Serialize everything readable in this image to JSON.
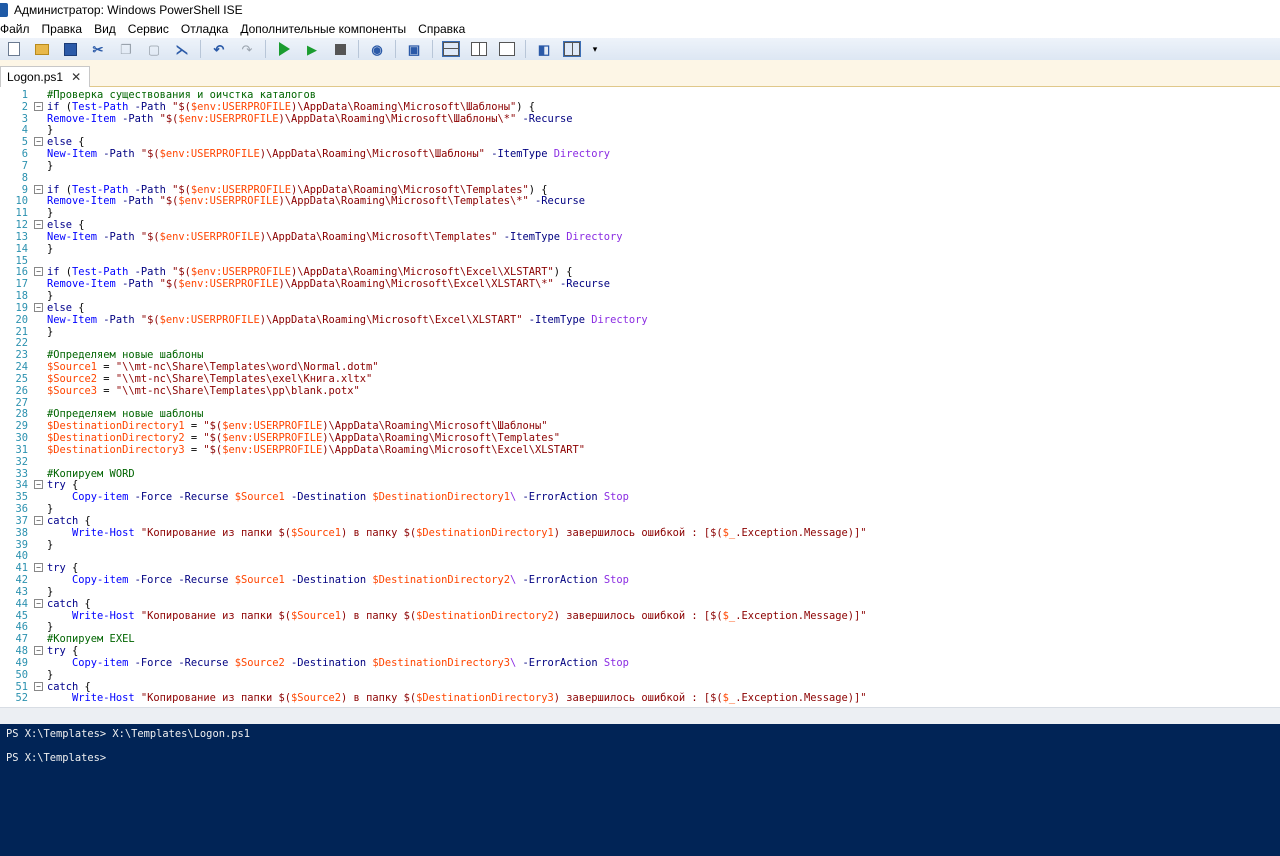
{
  "window": {
    "title": "Администратор: Windows PowerShell ISE"
  },
  "menu": [
    "Файл",
    "Правка",
    "Вид",
    "Сервис",
    "Отладка",
    "Дополнительные компоненты",
    "Справка"
  ],
  "toolbar": {
    "buttons": [
      "new-file-icon",
      "open-file-icon",
      "save-icon",
      "cut-icon",
      "copy-icon",
      "paste-icon",
      "clear-console-icon",
      "undo-icon",
      "redo-icon",
      "run-script-icon",
      "run-selection-icon",
      "stop-icon",
      "new-remote-tab-icon",
      "start-powershell-icon",
      "script-pane-top-icon",
      "script-pane-right-icon",
      "script-pane-maximized-icon",
      "show-commands-icon",
      "show-addon-icon",
      "overflow-icon"
    ]
  },
  "tabs": [
    {
      "label": "Logon.ps1",
      "close": "✕"
    }
  ],
  "editor": {
    "lines": [
      [
        {
          "t": "#Проверка существования и оичстка каталогов",
          "c": "comment"
        }
      ],
      [
        {
          "t": "if",
          "c": "kw"
        },
        {
          "t": " (",
          "c": ""
        },
        {
          "t": "Test-Path",
          "c": "cmd"
        },
        {
          "t": " -Path ",
          "c": "param"
        },
        {
          "t": "\"$(",
          "c": "str"
        },
        {
          "t": "$env:USERPROFILE",
          "c": "var"
        },
        {
          "t": ")\\AppData\\Roaming\\Microsoft\\Шаблоны\"",
          "c": "str"
        },
        {
          "t": ") {",
          "c": ""
        }
      ],
      [
        {
          "t": "Remove-Item",
          "c": "cmd"
        },
        {
          "t": " -Path ",
          "c": "param"
        },
        {
          "t": "\"$(",
          "c": "str"
        },
        {
          "t": "$env:USERPROFILE",
          "c": "var"
        },
        {
          "t": ")\\AppData\\Roaming\\Microsoft\\Шаблоны\\*\"",
          "c": "str"
        },
        {
          "t": " -Recurse",
          "c": "param"
        }
      ],
      [
        {
          "t": "}",
          "c": ""
        }
      ],
      [
        {
          "t": "else",
          "c": "kw"
        },
        {
          "t": " {",
          "c": ""
        }
      ],
      [
        {
          "t": "New-Item",
          "c": "cmd"
        },
        {
          "t": " -Path ",
          "c": "param"
        },
        {
          "t": "\"$(",
          "c": "str"
        },
        {
          "t": "$env:USERPROFILE",
          "c": "var"
        },
        {
          "t": ")\\AppData\\Roaming\\Microsoft\\Шаблоны\"",
          "c": "str"
        },
        {
          "t": " -ItemType ",
          "c": "param"
        },
        {
          "t": "Directory",
          "c": "arg"
        }
      ],
      [
        {
          "t": "}",
          "c": ""
        }
      ],
      [],
      [
        {
          "t": "if",
          "c": "kw"
        },
        {
          "t": " (",
          "c": ""
        },
        {
          "t": "Test-Path",
          "c": "cmd"
        },
        {
          "t": " -Path ",
          "c": "param"
        },
        {
          "t": "\"$(",
          "c": "str"
        },
        {
          "t": "$env:USERPROFILE",
          "c": "var"
        },
        {
          "t": ")\\AppData\\Roaming\\Microsoft\\Templates\"",
          "c": "str"
        },
        {
          "t": ") {",
          "c": ""
        }
      ],
      [
        {
          "t": "Remove-Item",
          "c": "cmd"
        },
        {
          "t": " -Path ",
          "c": "param"
        },
        {
          "t": "\"$(",
          "c": "str"
        },
        {
          "t": "$env:USERPROFILE",
          "c": "var"
        },
        {
          "t": ")\\AppData\\Roaming\\Microsoft\\Templates\\*\"",
          "c": "str"
        },
        {
          "t": " -Recurse",
          "c": "param"
        }
      ],
      [
        {
          "t": "}",
          "c": ""
        }
      ],
      [
        {
          "t": "else",
          "c": "kw"
        },
        {
          "t": " {",
          "c": ""
        }
      ],
      [
        {
          "t": "New-Item",
          "c": "cmd"
        },
        {
          "t": " -Path ",
          "c": "param"
        },
        {
          "t": "\"$(",
          "c": "str"
        },
        {
          "t": "$env:USERPROFILE",
          "c": "var"
        },
        {
          "t": ")\\AppData\\Roaming\\Microsoft\\Templates\"",
          "c": "str"
        },
        {
          "t": " -ItemType ",
          "c": "param"
        },
        {
          "t": "Directory",
          "c": "arg"
        }
      ],
      [
        {
          "t": "}",
          "c": ""
        }
      ],
      [],
      [
        {
          "t": "if",
          "c": "kw"
        },
        {
          "t": " (",
          "c": ""
        },
        {
          "t": "Test-Path",
          "c": "cmd"
        },
        {
          "t": " -Path ",
          "c": "param"
        },
        {
          "t": "\"$(",
          "c": "str"
        },
        {
          "t": "$env:USERPROFILE",
          "c": "var"
        },
        {
          "t": ")\\AppData\\Roaming\\Microsoft\\Excel\\XLSTART\"",
          "c": "str"
        },
        {
          "t": ") {",
          "c": ""
        }
      ],
      [
        {
          "t": "Remove-Item",
          "c": "cmd"
        },
        {
          "t": " -Path ",
          "c": "param"
        },
        {
          "t": "\"$(",
          "c": "str"
        },
        {
          "t": "$env:USERPROFILE",
          "c": "var"
        },
        {
          "t": ")\\AppData\\Roaming\\Microsoft\\Excel\\XLSTART\\*\"",
          "c": "str"
        },
        {
          "t": " -Recurse",
          "c": "param"
        }
      ],
      [
        {
          "t": "}",
          "c": ""
        }
      ],
      [
        {
          "t": "else",
          "c": "kw"
        },
        {
          "t": " {",
          "c": ""
        }
      ],
      [
        {
          "t": "New-Item",
          "c": "cmd"
        },
        {
          "t": " -Path ",
          "c": "param"
        },
        {
          "t": "\"$(",
          "c": "str"
        },
        {
          "t": "$env:USERPROFILE",
          "c": "var"
        },
        {
          "t": ")\\AppData\\Roaming\\Microsoft\\Excel\\XLSTART\"",
          "c": "str"
        },
        {
          "t": " -ItemType ",
          "c": "param"
        },
        {
          "t": "Directory",
          "c": "arg"
        }
      ],
      [
        {
          "t": "}",
          "c": ""
        }
      ],
      [],
      [
        {
          "t": "#Определяем новые шаблоны",
          "c": "comment"
        }
      ],
      [
        {
          "t": "$Source1",
          "c": "var"
        },
        {
          "t": " = ",
          "c": ""
        },
        {
          "t": "\"\\\\mt-nc\\Share\\Templates\\word\\Normal.dotm\"",
          "c": "str"
        }
      ],
      [
        {
          "t": "$Source2",
          "c": "var"
        },
        {
          "t": " = ",
          "c": ""
        },
        {
          "t": "\"\\\\mt-nc\\Share\\Templates\\exel\\Книга.xltx\"",
          "c": "str"
        }
      ],
      [
        {
          "t": "$Source3",
          "c": "var"
        },
        {
          "t": " = ",
          "c": ""
        },
        {
          "t": "\"\\\\mt-nc\\Share\\Templates\\pp\\blank.potx\"",
          "c": "str"
        }
      ],
      [],
      [
        {
          "t": "#Определяем новые шаблоны",
          "c": "comment"
        }
      ],
      [
        {
          "t": "$DestinationDirectory1",
          "c": "var"
        },
        {
          "t": " = ",
          "c": ""
        },
        {
          "t": "\"$(",
          "c": "str"
        },
        {
          "t": "$env:USERPROFILE",
          "c": "var"
        },
        {
          "t": ")\\AppData\\Roaming\\Microsoft\\Шаблоны\"",
          "c": "str"
        }
      ],
      [
        {
          "t": "$DestinationDirectory2",
          "c": "var"
        },
        {
          "t": " = ",
          "c": ""
        },
        {
          "t": "\"$(",
          "c": "str"
        },
        {
          "t": "$env:USERPROFILE",
          "c": "var"
        },
        {
          "t": ")\\AppData\\Roaming\\Microsoft\\Templates\"",
          "c": "str"
        }
      ],
      [
        {
          "t": "$DestinationDirectory3",
          "c": "var"
        },
        {
          "t": " = ",
          "c": ""
        },
        {
          "t": "\"$(",
          "c": "str"
        },
        {
          "t": "$env:USERPROFILE",
          "c": "var"
        },
        {
          "t": ")\\AppData\\Roaming\\Microsoft\\Excel\\XLSTART\"",
          "c": "str"
        }
      ],
      [],
      [
        {
          "t": "#Копируем WORD",
          "c": "comment"
        }
      ],
      [
        {
          "t": "try",
          "c": "kw"
        },
        {
          "t": " {",
          "c": ""
        }
      ],
      [
        {
          "t": "    ",
          "c": ""
        },
        {
          "t": "Copy-item",
          "c": "cmd"
        },
        {
          "t": " -Force -Recurse ",
          "c": "param"
        },
        {
          "t": "$Source1",
          "c": "var"
        },
        {
          "t": " -Destination ",
          "c": "param"
        },
        {
          "t": "$DestinationDirectory1",
          "c": "var"
        },
        {
          "t": "\\",
          "c": "arg"
        },
        {
          "t": " -ErrorAction ",
          "c": "param"
        },
        {
          "t": "Stop",
          "c": "arg"
        }
      ],
      [
        {
          "t": "}",
          "c": ""
        }
      ],
      [
        {
          "t": "catch",
          "c": "kw"
        },
        {
          "t": " {",
          "c": ""
        }
      ],
      [
        {
          "t": "    ",
          "c": ""
        },
        {
          "t": "Write-Host",
          "c": "cmd"
        },
        {
          "t": " \"Копирование из папки $(",
          "c": "str"
        },
        {
          "t": "$Source1",
          "c": "var"
        },
        {
          "t": ") в папку $(",
          "c": "str"
        },
        {
          "t": "$DestinationDirectory1",
          "c": "var"
        },
        {
          "t": ") завершилось ошибкой : [$(",
          "c": "str"
        },
        {
          "t": "$_",
          "c": "var"
        },
        {
          "t": ".Exception.Message)]\"",
          "c": "str"
        }
      ],
      [
        {
          "t": "}",
          "c": ""
        }
      ],
      [],
      [
        {
          "t": "try",
          "c": "kw"
        },
        {
          "t": " {",
          "c": ""
        }
      ],
      [
        {
          "t": "    ",
          "c": ""
        },
        {
          "t": "Copy-item",
          "c": "cmd"
        },
        {
          "t": " -Force -Recurse ",
          "c": "param"
        },
        {
          "t": "$Source1",
          "c": "var"
        },
        {
          "t": " -Destination ",
          "c": "param"
        },
        {
          "t": "$DestinationDirectory2",
          "c": "var"
        },
        {
          "t": "\\",
          "c": "arg"
        },
        {
          "t": " -ErrorAction ",
          "c": "param"
        },
        {
          "t": "Stop",
          "c": "arg"
        }
      ],
      [
        {
          "t": "}",
          "c": ""
        }
      ],
      [
        {
          "t": "catch",
          "c": "kw"
        },
        {
          "t": " {",
          "c": ""
        }
      ],
      [
        {
          "t": "    ",
          "c": ""
        },
        {
          "t": "Write-Host",
          "c": "cmd"
        },
        {
          "t": " \"Копирование из папки $(",
          "c": "str"
        },
        {
          "t": "$Source1",
          "c": "var"
        },
        {
          "t": ") в папку $(",
          "c": "str"
        },
        {
          "t": "$DestinationDirectory2",
          "c": "var"
        },
        {
          "t": ") завершилось ошибкой : [$(",
          "c": "str"
        },
        {
          "t": "$_",
          "c": "var"
        },
        {
          "t": ".Exception.Message)]\"",
          "c": "str"
        }
      ],
      [
        {
          "t": "}",
          "c": ""
        }
      ],
      [
        {
          "t": "#Копируем EXEL",
          "c": "comment"
        }
      ],
      [
        {
          "t": "try",
          "c": "kw"
        },
        {
          "t": " {",
          "c": ""
        }
      ],
      [
        {
          "t": "    ",
          "c": ""
        },
        {
          "t": "Copy-item",
          "c": "cmd"
        },
        {
          "t": " -Force -Recurse ",
          "c": "param"
        },
        {
          "t": "$Source2",
          "c": "var"
        },
        {
          "t": " -Destination ",
          "c": "param"
        },
        {
          "t": "$DestinationDirectory3",
          "c": "var"
        },
        {
          "t": "\\",
          "c": "arg"
        },
        {
          "t": " -ErrorAction ",
          "c": "param"
        },
        {
          "t": "Stop",
          "c": "arg"
        }
      ],
      [
        {
          "t": "}",
          "c": ""
        }
      ],
      [
        {
          "t": "catch",
          "c": "kw"
        },
        {
          "t": " {",
          "c": ""
        }
      ],
      [
        {
          "t": "    ",
          "c": ""
        },
        {
          "t": "Write-Host",
          "c": "cmd"
        },
        {
          "t": " \"Копирование из папки $(",
          "c": "str"
        },
        {
          "t": "$Source2",
          "c": "var"
        },
        {
          "t": ") в папку $(",
          "c": "str"
        },
        {
          "t": "$DestinationDirectory3",
          "c": "var"
        },
        {
          "t": ") завершилось ошибкой : [$(",
          "c": "str"
        },
        {
          "t": "$_",
          "c": "var"
        },
        {
          "t": ".Exception.Message)]\"",
          "c": "str"
        }
      ]
    ],
    "fold_lines": [
      2,
      5,
      9,
      12,
      16,
      19,
      34,
      37,
      41,
      44,
      48,
      51
    ]
  },
  "console": {
    "lines": [
      "PS X:\\Templates> X:\\Templates\\Logon.ps1",
      "",
      "PS X:\\Templates>"
    ]
  }
}
